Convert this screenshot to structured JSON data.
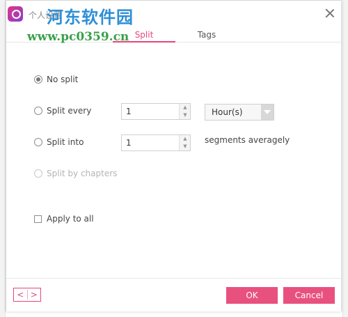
{
  "watermark": {
    "cn_text": "河东软件园",
    "url": "www.pc0359.cn"
  },
  "dialog": {
    "title": "个人设置"
  },
  "tabs": [
    {
      "label": "Split",
      "active": true
    },
    {
      "label": "Tags",
      "active": false
    }
  ],
  "split": {
    "options": [
      {
        "label": "No split",
        "checked": true,
        "disabled": false
      },
      {
        "label": "Split every",
        "checked": false,
        "disabled": false
      },
      {
        "label": "Split into",
        "checked": false,
        "disabled": false
      },
      {
        "label": "Split by chapters",
        "checked": false,
        "disabled": true
      }
    ],
    "every_value": "1",
    "every_unit": "Hour(s)",
    "into_value": "1",
    "segments_label": "segments averagely",
    "apply_all_label": "Apply to all",
    "apply_all_checked": false
  },
  "footer": {
    "prev_glyph": "<",
    "next_glyph": ">",
    "ok_label": "OK",
    "cancel_label": "Cancel"
  },
  "colors": {
    "accent": "#e5467a",
    "button": "#e8517e",
    "watermark_blue": "#2e8fd6",
    "watermark_green": "#3aa14a"
  }
}
